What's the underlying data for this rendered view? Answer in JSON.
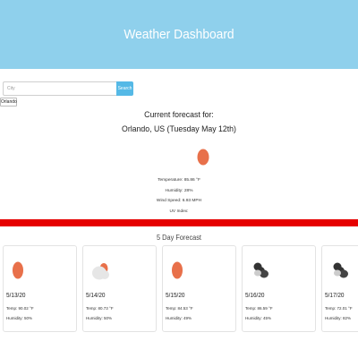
{
  "header": {
    "title": "Weather Dashboard"
  },
  "search": {
    "placeholder": "City",
    "value": "",
    "button_label": "Search"
  },
  "history": [
    "Orlando"
  ],
  "current": {
    "title_line1": "Current forecast for:",
    "title_line2": "Orlando, US (Tuesday May 12th)",
    "icon": "sun-icon",
    "temperature": "Temperature: 85.86 °F",
    "humidity": "Humidity: 28%",
    "wind": "Wind Speed: 6.93 MPH",
    "uv": "UV Index:"
  },
  "five_day": {
    "title": "5 Day Forecast",
    "days": [
      {
        "date": "5/13/20",
        "temp": "Temp: 90.02 °F",
        "humidity": "Humidity: 50%",
        "icon": "sun-icon"
      },
      {
        "date": "5/14/20",
        "temp": "Temp: 80.73 °F",
        "humidity": "Humidity: 50%",
        "icon": "partly-cloudy-icon"
      },
      {
        "date": "5/15/20",
        "temp": "Temp: 84.53 °F",
        "humidity": "Humidity: 49%",
        "icon": "sun-icon"
      },
      {
        "date": "5/16/20",
        "temp": "Temp: 86.59 °F",
        "humidity": "Humidity: 45%",
        "icon": "broken-clouds-icon"
      },
      {
        "date": "5/17/20",
        "temp": "Temp: 72.01 °F",
        "humidity": "Humidity: 82%",
        "icon": "broken-clouds-icon"
      }
    ]
  },
  "colors": {
    "header_bg": "#8fd0ec",
    "search_button": "#55b9e6",
    "sun": "#e8704a",
    "divider_red": "#e60000"
  }
}
